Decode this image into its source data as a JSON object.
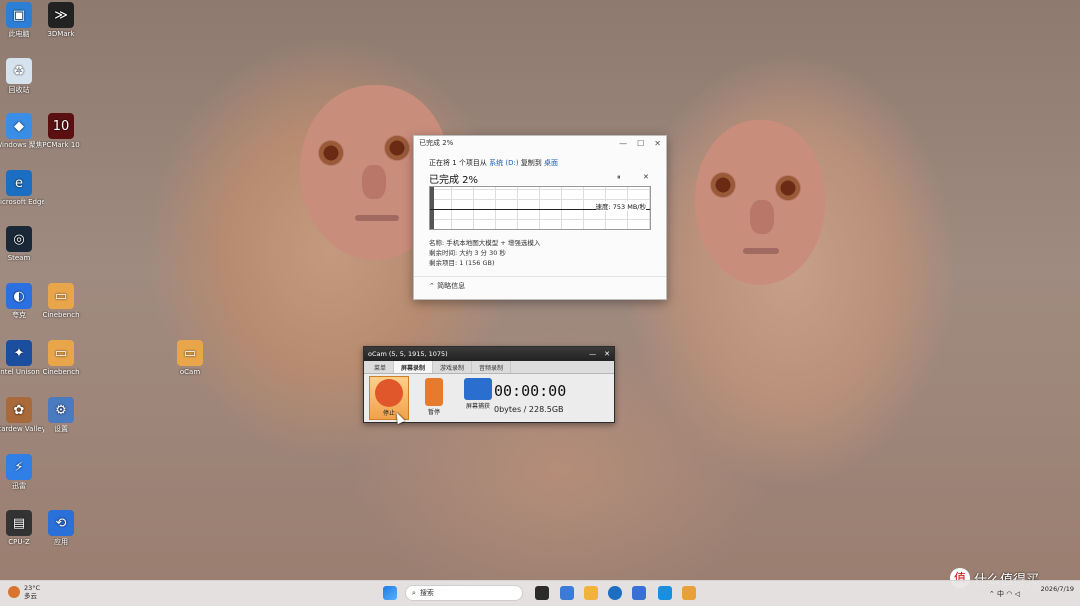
{
  "desktop": {
    "icons": [
      {
        "label": "此电脑",
        "color": "#2d7fd6",
        "glyph": "▣"
      },
      {
        "label": "3DMark",
        "color": "#222222",
        "glyph": "≫"
      },
      {
        "label": "回收站",
        "color": "#d6e3ef",
        "glyph": "♻"
      },
      {
        "label": "Windows 聚焦",
        "color": "#3a8ee6",
        "glyph": "◆"
      },
      {
        "label": "PCMark 10",
        "color": "#5a1010",
        "glyph": "10"
      },
      {
        "label": "Microsoft Edge",
        "color": "#1b6ec2",
        "glyph": "e"
      },
      {
        "label": "Steam",
        "color": "#1b2838",
        "glyph": "◎"
      },
      {
        "label": "夸克",
        "color": "#2b6fe0",
        "glyph": "◐"
      },
      {
        "label": "Cinebench",
        "color": "#e9a54a",
        "glyph": "▭"
      },
      {
        "label": "Intel Unison",
        "color": "#1c4ea0",
        "glyph": "✦"
      },
      {
        "label": "Cinebench",
        "color": "#e9a54a",
        "glyph": "▭"
      },
      {
        "label": "oCam",
        "color": "#e9a54a",
        "glyph": "▭"
      },
      {
        "label": "Stardew Valley",
        "color": "#a86a3a",
        "glyph": "✿"
      },
      {
        "label": "设置",
        "color": "#4a7ac0",
        "glyph": "⚙"
      },
      {
        "label": "迅雷",
        "color": "#2f7fe6",
        "glyph": "⚡"
      },
      {
        "label": "CPU-Z",
        "color": "#333333",
        "glyph": "▤"
      },
      {
        "label": "应用",
        "color": "#2a70d8",
        "glyph": "⟲"
      }
    ]
  },
  "copy_dialog": {
    "title": "已完成 2%",
    "status_prefix": "正在将 1 个项目从",
    "source": "系统 (D:)",
    "status_mid": "复制到",
    "destination": "桌面",
    "percent_label": "已完成 2%",
    "pause_glyph": "⏸",
    "close_glyph": "✕",
    "speed": "速度: 753 MB/秒",
    "name_line": "名称: 手机本地图大模型 + 增强选模入",
    "time_line": "剩余时间: 大约 3 分 30 秒",
    "items_line": "剩余项目: 1 (156 GB)",
    "less_details": "简略信息",
    "progress": 0.02
  },
  "ocam": {
    "title": "oCam (5, 5, 1915, 1075)",
    "tabs": [
      "菜单",
      "屏幕录制",
      "游戏录制",
      "音频录制"
    ],
    "active_tab": "屏幕录制",
    "tools": [
      {
        "label": "停止",
        "color": "#e0572b"
      },
      {
        "label": "暂停",
        "color": "#e77a2d"
      },
      {
        "label": "屏幕捕获",
        "color": "#2a6fd0"
      }
    ],
    "timer": "00:00:00",
    "size": "0bytes / 228.5GB"
  },
  "taskbar": {
    "weather_temp": "23°C",
    "weather_desc": "多云",
    "search_placeholder": "搜索",
    "clock_time": "",
    "clock_date": "2026/7/19",
    "tray": "中"
  },
  "watermark": {
    "icon": "值",
    "text": "什么值得买"
  }
}
